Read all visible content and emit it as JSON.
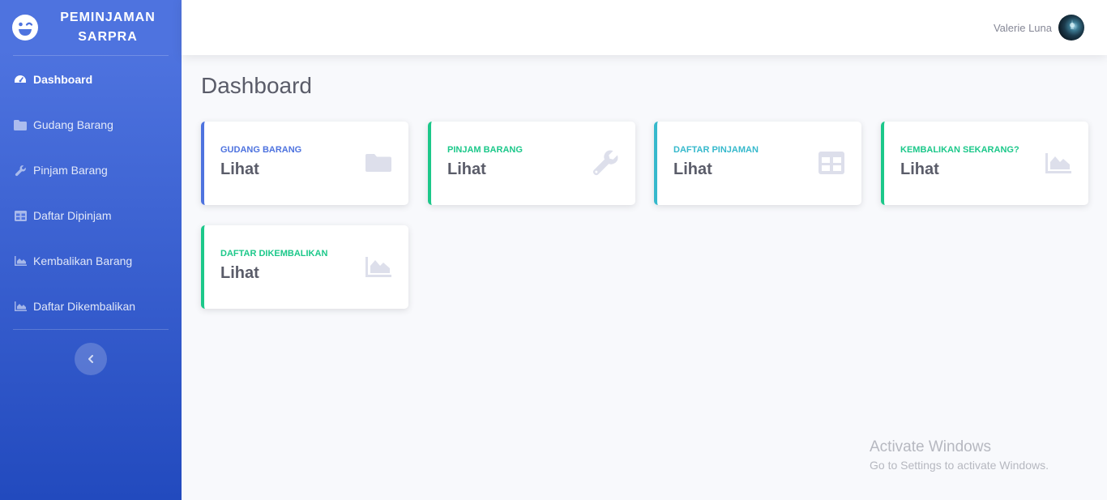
{
  "brand": {
    "line1": "PEMINJAMAN",
    "line2": "SARPRA"
  },
  "sidebar": {
    "items": [
      {
        "label": "Dashboard",
        "icon": "tachometer-icon",
        "active": true
      },
      {
        "label": "Gudang Barang",
        "icon": "folder-icon"
      },
      {
        "label": "Pinjam Barang",
        "icon": "wrench-icon"
      },
      {
        "label": "Daftar Dipinjam",
        "icon": "table-icon"
      },
      {
        "label": "Kembalikan Barang",
        "icon": "area-chart-icon"
      },
      {
        "label": "Daftar Dikembalikan",
        "icon": "area-chart-icon"
      }
    ],
    "toggle_icon": "chevron-left-icon"
  },
  "topbar": {
    "user_name": "Valerie Luna"
  },
  "main": {
    "title": "Dashboard",
    "cards": [
      {
        "label": "GUDANG BARANG",
        "value": "Lihat",
        "icon": "folder-icon",
        "color": "#4e73df"
      },
      {
        "label": "PINJAM BARANG",
        "value": "Lihat",
        "icon": "wrench-icon",
        "color": "#1cc88a"
      },
      {
        "label": "DAFTAR PINJAMAN",
        "value": "Lihat",
        "icon": "table-icon",
        "color": "#36b9cc"
      },
      {
        "label": "KEMBALIKAN SEKARANG?",
        "value": "Lihat",
        "icon": "area-chart-icon",
        "color": "#1cc88a"
      },
      {
        "label": "DAFTAR DIKEMBALIKAN",
        "value": "Lihat",
        "icon": "area-chart-icon",
        "color": "#1cc88a"
      }
    ]
  },
  "watermark": {
    "title": "Activate Windows",
    "subtitle": "Go to Settings to activate Windows."
  },
  "colors": {
    "primary": "#4e73df",
    "success": "#1cc88a",
    "info": "#36b9cc",
    "text": "#5a5c69",
    "icon_gray": "#dddfeb"
  }
}
